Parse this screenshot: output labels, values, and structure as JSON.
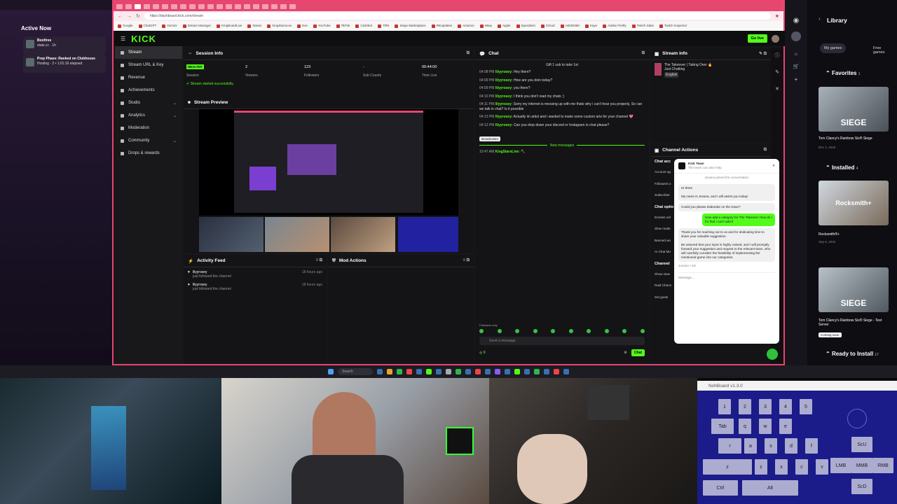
{
  "left_panel": {
    "title": "Active Now",
    "items": [
      {
        "name": "Boofires",
        "sub": "stats.cc · 1h"
      },
      {
        "name": "Prep Phase: Ranked on Clubhouse",
        "sub": "Hosting · 2 • 1:01:16 elapsed"
      }
    ]
  },
  "browser": {
    "url": "https://dashboard.kick.com/stream",
    "bookmarks": [
      "Google",
      "ChatGPT",
      "Gemini",
      "Stream Manager",
      "KingBoardLive",
      "Steam",
      "KingStarsLive",
      "Eve",
      "YouTube",
      "TikTok",
      "Cashbot",
      "TRN",
      "Siege Marketplace",
      "R6Updates",
      "Amazon",
      "eBay",
      "Apple",
      "Speedtest",
      "iCloud",
      "ADHD360",
      "Kaye",
      "Adobe Firefly",
      "Twitch Stats",
      "Twitch Inspector"
    ]
  },
  "kick": {
    "logo": "KICK",
    "go_live": "Go live",
    "nav": [
      {
        "label": "Stream",
        "active": true
      },
      {
        "label": "Stream URL & Key"
      },
      {
        "label": "Revenue"
      },
      {
        "label": "Achievements"
      },
      {
        "label": "Studio",
        "chev": "⌄"
      },
      {
        "label": "Analytics",
        "chev": "⌄"
      },
      {
        "label": "Moderation"
      },
      {
        "label": "Community",
        "chev": "⌄"
      },
      {
        "label": "Drops & rewards"
      }
    ],
    "session": {
      "title": "Session Info",
      "health": "HEALTHY",
      "session_label": "Session",
      "viewers": "2",
      "viewers_label": "Viewers",
      "followers": "123",
      "followers_label": "Followers",
      "subs": "-",
      "subs_label": "Sub Counts",
      "time": "00:44:00",
      "time_label": "Time Live",
      "status": "Stream started successfully."
    },
    "preview_title": "Stream Preview",
    "activity": {
      "title": "Activity Feed",
      "items": [
        {
          "user": "lilyyrosey",
          "action": "just followed the channel",
          "time": "18 hours ago"
        },
        {
          "user": "lilyyrosey",
          "action": "just followed the channel",
          "time": "18 hours ago"
        }
      ]
    },
    "mod_actions": "Mod Actions",
    "chat": {
      "title": "Chat",
      "gift": "Gift 1 sub to take 1st",
      "messages": [
        {
          "time": "04:08 PM",
          "user": "lilyyrosey:",
          "text": "Hey there?"
        },
        {
          "time": "04:09 PM",
          "user": "lilyyrosey:",
          "text": "How are you doin today?"
        },
        {
          "time": "04:09 PM",
          "user": "lilyyrosey:",
          "text": "you there?"
        },
        {
          "time": "04:10 PM",
          "user": "lilyyrosey:",
          "text": "I think you don't read my chats :)"
        },
        {
          "time": "04:11 PM",
          "user": "lilyyrosey:",
          "text": "Sorry my internet is messing up with me thats why i can't hear you properly, So can we talk in chat? Is it possible"
        },
        {
          "time": "04:13 PM",
          "user": "lilyyrosey:",
          "text": "Actually im artist and i wanted to make some custom arts for your channel 💖"
        },
        {
          "time": "04:12 PM",
          "user": "lilyyrosey:",
          "text": "Can you drop down your discord or Instagram in chat please?"
        }
      ],
      "broadcaster_badge": "Broadcaster",
      "new_messages": "New messages",
      "last": {
        "time": "10:47 AM",
        "user": "KingStarsLive:",
        "text": "🔨"
      },
      "followers_only": "Followers only",
      "placeholder": "Send a message",
      "count": "0",
      "send": "Chat"
    },
    "stream_info": {
      "title": "Stream info",
      "stream_title": "The Takeover | Taking Over 🔥",
      "category": "Just Chatting",
      "language": "English"
    },
    "channel_actions": {
      "title": "Channel Actions",
      "items": [
        "Chat acc",
        "Account ag",
        "Followers o",
        "Subscriber",
        "Chat optio",
        "Emotes onl",
        "Slow mode",
        "Banned wo",
        "AI Chat Mo",
        "Channel",
        "Show view",
        "Raid Chann",
        "Set goals"
      ]
    },
    "support": {
      "name": "Kick Team",
      "sub": "The team can also help",
      "joined": "Jovana joined the conversation",
      "m1": "Hi there",
      "m2": "My name is Jovana, and I will assist you today!",
      "m3": "Could you please elaborate on the issue?",
      "me": "How add a category for The Takeover How do I for that I can't add it",
      "m4": "Thank you for reaching out to us and for dedicating time to share your valuable suggestion.",
      "m5": "Be assured that your input is highly valued, and I will promptly forward your suggestion and request to the relevant team, who will carefully consider the feasibility of implementing the mentioned game into our categories.",
      "sig": "Jovana • 2m",
      "input": "Message…"
    }
  },
  "library": {
    "title": "Library",
    "tabs": [
      "My games",
      "Free games"
    ],
    "favorites": "Favorites",
    "fav_count": "1",
    "installed": "Installed",
    "inst_count": "4",
    "ready": "Ready to Install",
    "ready_count": "17",
    "games": [
      {
        "name": "Tom Clancy's Rainbow Six® Siege",
        "date": "Dec 1, 2015",
        "art": "SIEGE"
      },
      {
        "name": "Rocksmith®+",
        "date": "Sep 6, 2022",
        "art": "Rocksmith+"
      },
      {
        "name": "Tom Clancy's Rainbow Six® Siege - Test Server",
        "date": "Coming soon",
        "art": "SIEGE"
      }
    ]
  },
  "taskbar": {
    "search": "Search"
  },
  "nohboard": {
    "title": "NohBoard v1.3.0",
    "keys": [
      "1",
      "2",
      "3",
      "4",
      "5",
      "Tab",
      "q",
      "w",
      "e",
      "r",
      "a",
      "s",
      "d",
      "f",
      "z",
      "x",
      "c",
      "v",
      "Ctrl",
      "Alt",
      "ScU",
      "LMB",
      "MMB",
      "RMB",
      "ScD"
    ]
  }
}
